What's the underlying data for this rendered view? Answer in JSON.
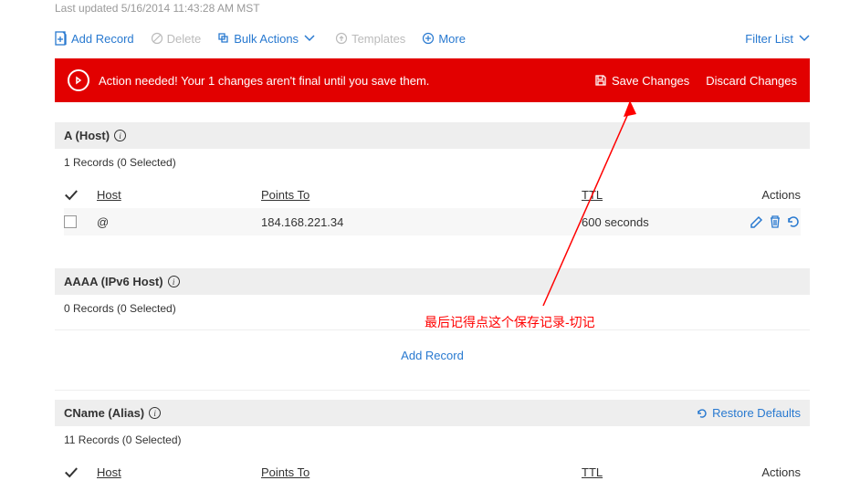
{
  "timestamp": "Last updated 5/16/2014 11:43:28 AM MST",
  "toolbar": {
    "add_record": "Add Record",
    "delete": "Delete",
    "bulk_actions": "Bulk Actions",
    "templates": "Templates",
    "more": "More",
    "filter_list": "Filter List"
  },
  "alert": {
    "message": "Action needed! Your 1 changes aren't final until you save them.",
    "save": "Save Changes",
    "discard": "Discard Changes"
  },
  "sections": {
    "a_host": {
      "title": "A (Host)",
      "count": "1 Records (0 Selected)",
      "headers": {
        "host": "Host",
        "points_to": "Points To",
        "ttl": "TTL",
        "actions": "Actions"
      },
      "row": {
        "host": "@",
        "points_to": "184.168.221.34",
        "ttl": "600 seconds"
      }
    },
    "aaaa": {
      "title": "AAAA (IPv6 Host)",
      "count": "0 Records (0 Selected)",
      "add_record": "Add Record"
    },
    "cname": {
      "title": "CName (Alias)",
      "count": "11 Records (0 Selected)",
      "restore": "Restore Defaults",
      "headers": {
        "host": "Host",
        "points_to": "Points To",
        "ttl": "TTL",
        "actions": "Actions"
      }
    }
  },
  "annotation": "最后记得点这个保存记录-切记"
}
